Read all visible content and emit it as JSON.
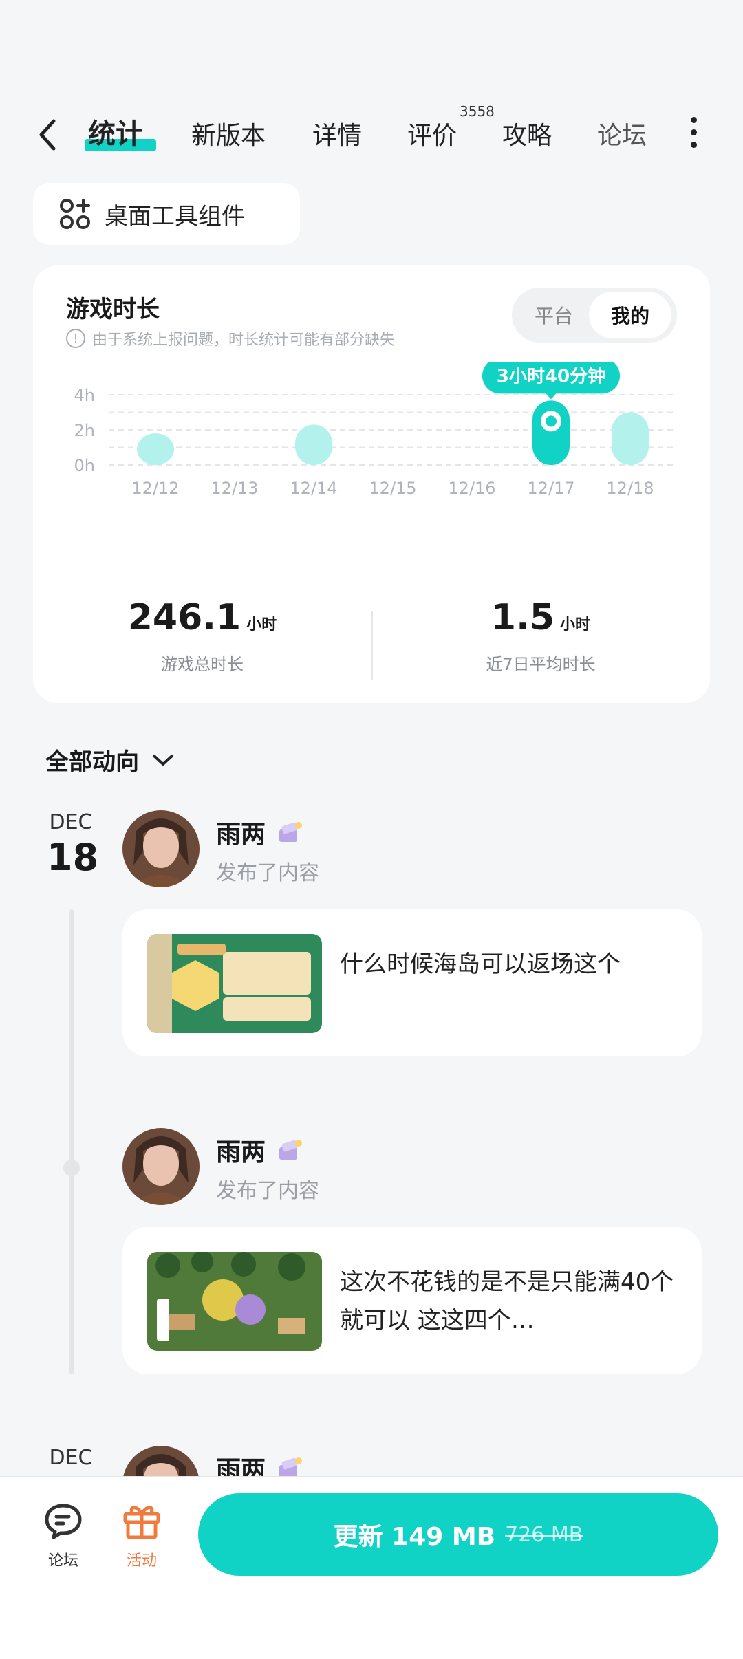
{
  "tabs": [
    {
      "label": "统计",
      "active": true
    },
    {
      "label": "新版本"
    },
    {
      "label": "详情"
    },
    {
      "label": "评价",
      "count": "3558"
    },
    {
      "label": "攻略"
    },
    {
      "label": "论坛"
    }
  ],
  "widget": {
    "label": "桌面工具组件",
    "icon": "grid-plus-icon"
  },
  "playtime": {
    "title": "游戏时长",
    "note": "由于系统上报问题，时长统计可能有部分缺失",
    "segment": {
      "platform": "平台",
      "mine": "我的"
    },
    "tooltip": "3小时40分钟"
  },
  "chart_data": {
    "type": "bar",
    "categories": [
      "12/12",
      "12/13",
      "12/14",
      "12/15",
      "12/16",
      "12/17",
      "12/18"
    ],
    "values": [
      1.8,
      0,
      2.3,
      0,
      0,
      3.67,
      3.0
    ],
    "yticks": [
      "0h",
      "2h",
      "4h"
    ],
    "ylim": [
      0,
      4
    ],
    "highlight_index": 5,
    "colors": {
      "bar": "#b2f1ec",
      "highlight": "#10d3c5"
    },
    "grid": true
  },
  "stats": {
    "total": {
      "value": "246.1",
      "unit": "小时",
      "label": "游戏总时长"
    },
    "avg": {
      "value": "1.5",
      "unit": "小时",
      "label": "近7日平均时长"
    }
  },
  "feed": {
    "filter": "全部动向",
    "date1": {
      "month": "DEC",
      "day": "18"
    },
    "date2": {
      "month": "DEC"
    },
    "posts": [
      {
        "user": "雨两",
        "action": "发布了内容",
        "text": "什么时候海岛可以返场这个"
      },
      {
        "user": "雨两",
        "action": "发布了内容",
        "text": "这次不花钱的是不是只能满40个就可以 这这四个…"
      },
      {
        "user": "雨两"
      }
    ]
  },
  "bottom": {
    "forum": "论坛",
    "activity": "活动",
    "update": "更新 149 MB",
    "old_size": "726 MB",
    "accent": "#10d3c5",
    "activity_color": "#f07b3f"
  }
}
